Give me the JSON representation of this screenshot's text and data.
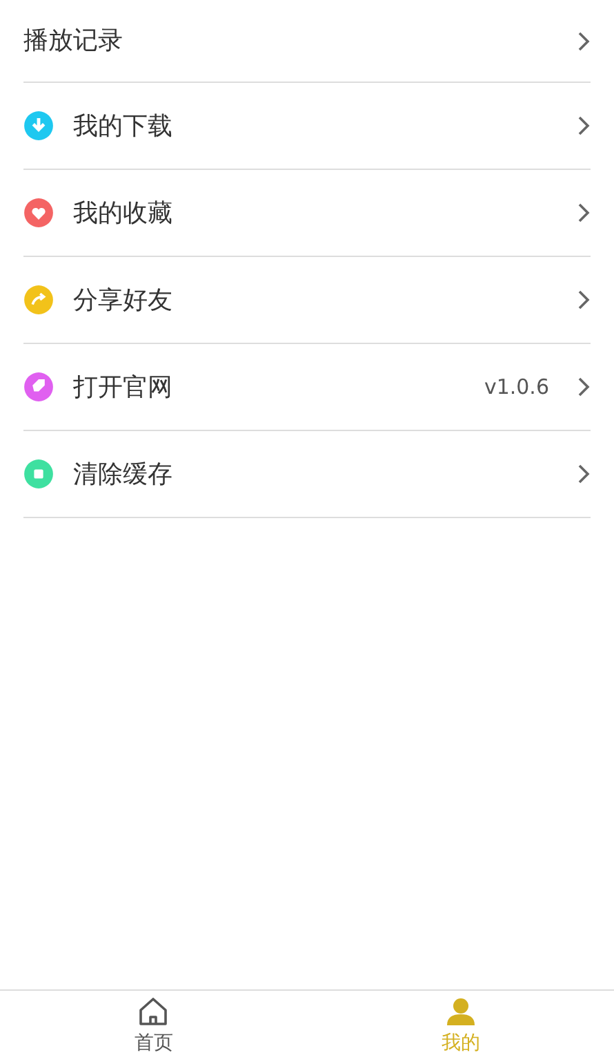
{
  "menu": [
    {
      "label": "播放记录",
      "kind": "plain"
    },
    {
      "label": "我的下载",
      "kind": "download",
      "color": "#1ec8f0"
    },
    {
      "label": "我的收藏",
      "kind": "heart",
      "color": "#f46464"
    },
    {
      "label": "分享好友",
      "kind": "share",
      "color": "#f2c21a"
    },
    {
      "label": "打开官网",
      "kind": "tag",
      "color": "#e060f0",
      "value": "v1.0.6"
    },
    {
      "label": "清除缓存",
      "kind": "trash",
      "color": "#3ee0a0"
    }
  ],
  "tabbar": [
    {
      "label": "首页",
      "kind": "home",
      "selected": false
    },
    {
      "label": "我的",
      "kind": "user",
      "selected": true
    }
  ]
}
